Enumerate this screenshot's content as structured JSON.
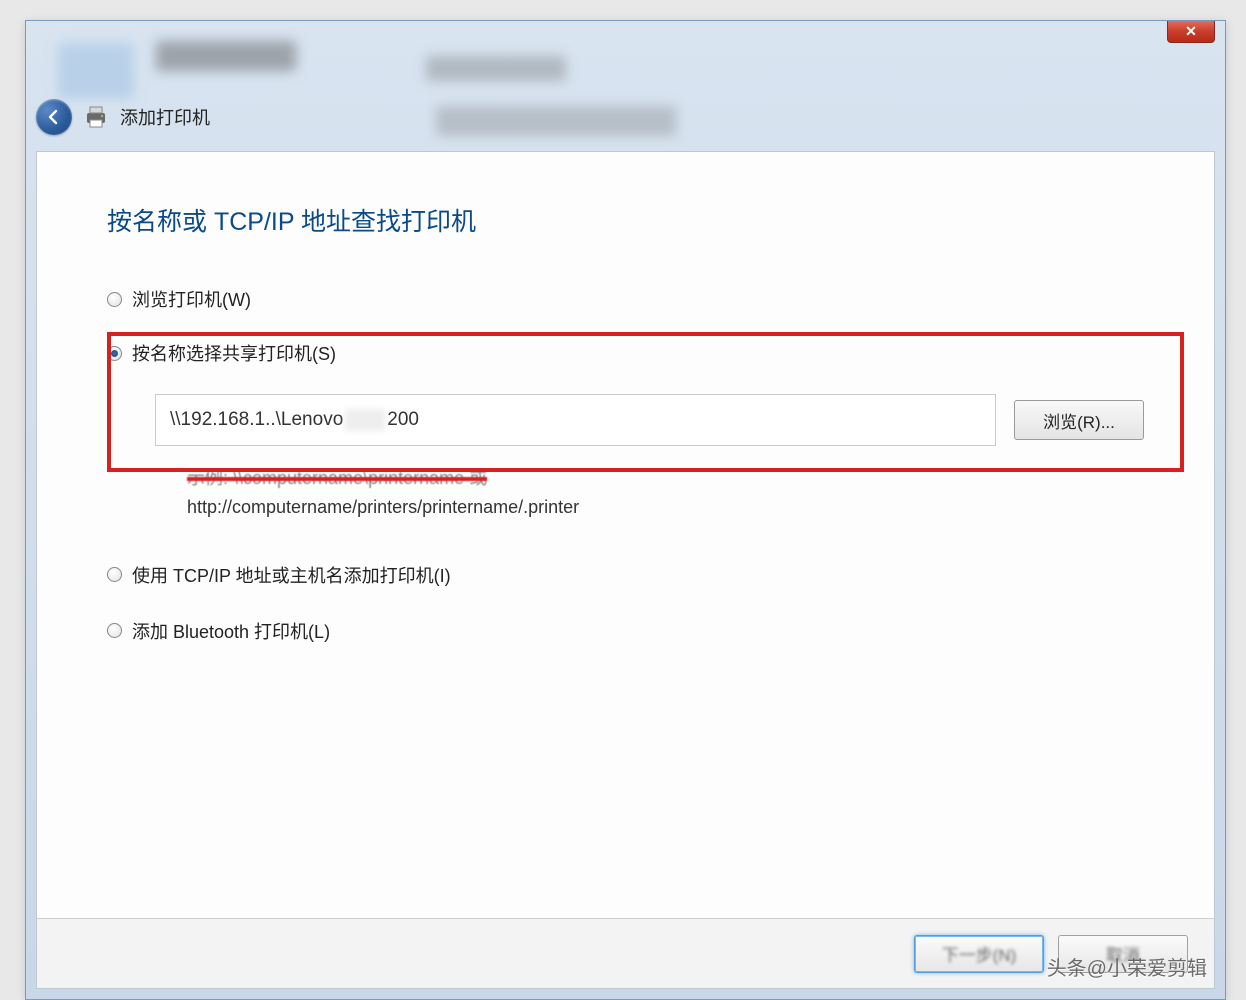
{
  "window": {
    "close_icon": "✕"
  },
  "header": {
    "title": "添加打印机"
  },
  "content": {
    "heading": "按名称或 TCP/IP 地址查找打印机",
    "option_browse": "浏览打印机(W)",
    "option_byname": "按名称选择共享打印机(S)",
    "path_prefix": "\\\\192.168.1..\\Lenovo",
    "path_suffix": "200",
    "browse_button": "浏览(R)...",
    "example_line1": "示例: \\\\computername\\printername 或",
    "example_line2": "http://computername/printers/printername/.printer",
    "option_tcpip": "使用 TCP/IP 地址或主机名添加打印机(I)",
    "option_bluetooth": "添加 Bluetooth 打印机(L)"
  },
  "footer": {
    "next": "下一步(N)",
    "cancel": "取消"
  },
  "watermark": "头条@小荣爱剪辑"
}
